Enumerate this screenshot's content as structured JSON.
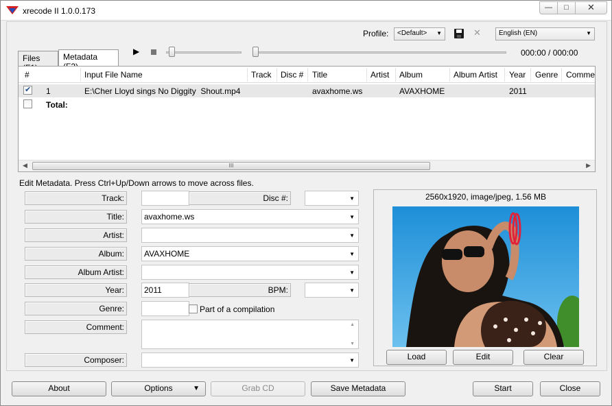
{
  "window": {
    "title": "xrecode II 1.0.0.173"
  },
  "top": {
    "profile_label": "Profile:",
    "profile_value": "<Default>",
    "language_value": "English (EN)",
    "time": "000:00 / 000:00"
  },
  "tabs": [
    {
      "label": "Files (F1)"
    },
    {
      "label": "Metadata (F2)"
    }
  ],
  "table": {
    "headers": [
      "#",
      "Input File Name",
      "Track",
      "Disc #",
      "Title",
      "Artist",
      "Album",
      "Album Artist",
      "Year",
      "Genre",
      "Comme"
    ],
    "row": {
      "num": "1",
      "file": "E:\\Cher Lloyd sings No Diggity  Shout.mp4",
      "title": "avaxhome.ws",
      "album": "AVAXHOME",
      "year": "2011"
    },
    "total_label": "Total:",
    "scroll_grip": "III"
  },
  "edit": {
    "title": "Edit Metadata. Press Ctrl+Up/Down arrows to move across files.",
    "track_label": "Track:",
    "disc_label": "Disc #:",
    "title_label": "Title:",
    "title_value": "avaxhome.ws",
    "artist_label": "Artist:",
    "album_label": "Album:",
    "album_value": "AVAXHOME",
    "album_artist_label": "Album Artist:",
    "year_label": "Year:",
    "year_value": "2011",
    "bpm_label": "BPM:",
    "genre_label": "Genre:",
    "compilation_label": "Part of a compilation",
    "comment_label": "Comment:",
    "composer_label": "Composer:"
  },
  "art": {
    "info": "2560x1920, image/jpeg, 1.56 MB",
    "load": "Load",
    "edit": "Edit",
    "clear": "Clear"
  },
  "bottom": {
    "about": "About",
    "options": "Options",
    "grab_cd": "Grab CD",
    "save_metadata": "Save Metadata",
    "start": "Start",
    "close": "Close"
  },
  "icons": {
    "minimize": "minimize-icon",
    "maximize": "maximize-icon",
    "close": "close-icon",
    "save_profile": "floppy-icon",
    "delete_profile": "x-icon",
    "play": "play-icon",
    "stop": "stop-icon"
  }
}
